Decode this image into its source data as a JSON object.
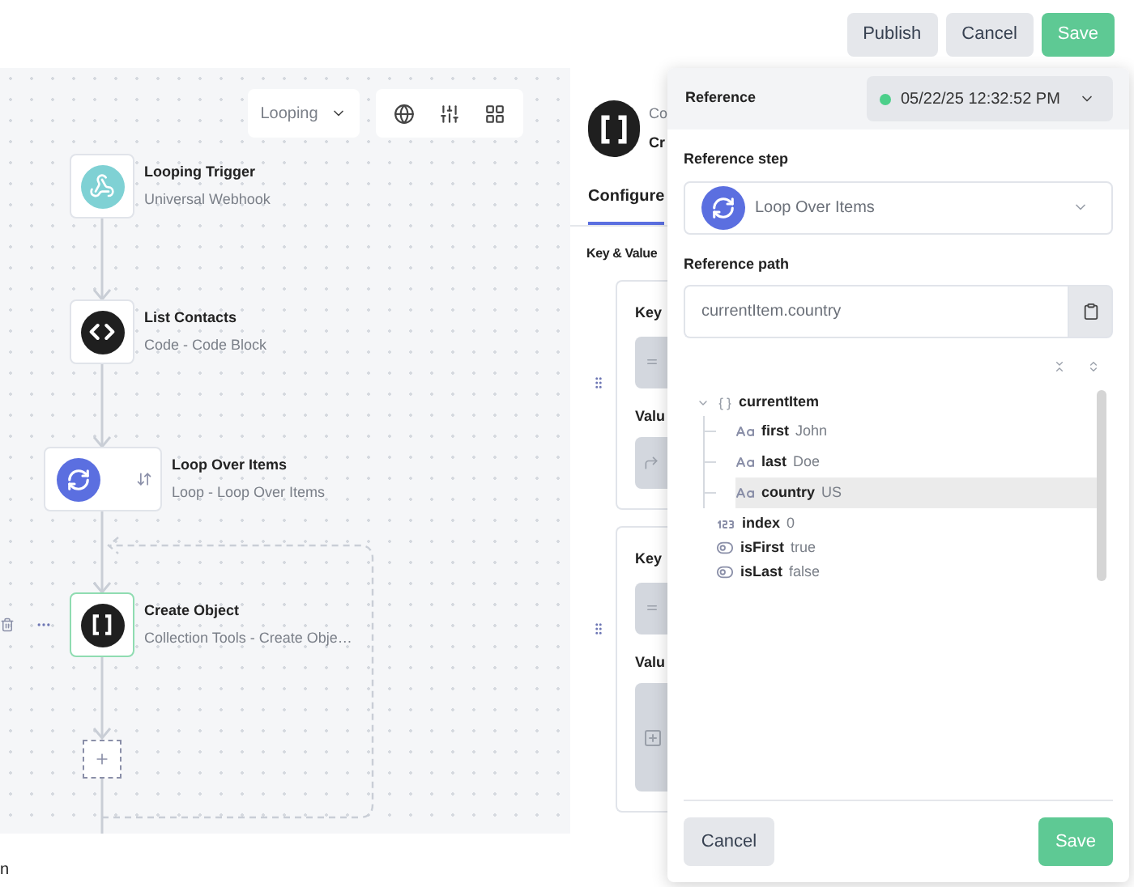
{
  "header": {
    "buttons": [
      {
        "label": "Publish",
        "kind": "secondary"
      },
      {
        "label": "Cancel",
        "kind": "secondary"
      },
      {
        "label": "Save",
        "kind": "primary"
      }
    ]
  },
  "canvas": {
    "view_select": "Looping",
    "nodes": [
      {
        "title": "Looping Trigger",
        "subtitle": "Universal Webhook",
        "kind": "webhook",
        "selected": false
      },
      {
        "title": "List Contacts",
        "subtitle": "Code - Code Block",
        "kind": "code",
        "selected": false
      },
      {
        "title": "Loop Over Items",
        "subtitle": "Loop - Loop Over Items",
        "kind": "loop",
        "selected": false
      },
      {
        "title": "Create Object",
        "subtitle": "Collection Tools - Create Obje…",
        "kind": "object",
        "selected": true
      }
    ]
  },
  "step_panel": {
    "title": "Co",
    "subtitle": "Cr",
    "tabs": [
      {
        "label": "Configure",
        "selected": true
      }
    ],
    "section": "Key & Value",
    "cards": [
      {
        "key_label": "Key",
        "value_label": "Valu",
        "kind": "reference"
      },
      {
        "key_label": "Key",
        "value_label": "Valu",
        "kind": "insert"
      }
    ]
  },
  "reference_popover": {
    "title": "Reference",
    "run": {
      "label": "05/22/25 12:32:52 PM",
      "color": "#4ccf8a"
    },
    "step_label": "Reference step",
    "step_value": "Loop Over Items",
    "path_label": "Reference path",
    "path_value": "currentItem.country",
    "tree": [
      {
        "kind": "object",
        "key": "currentItem",
        "expanded": true,
        "selected": false,
        "children": [
          {
            "kind": "string",
            "key": "first",
            "value": "John",
            "selected": false
          },
          {
            "kind": "string",
            "key": "last",
            "value": "Doe",
            "selected": false
          },
          {
            "kind": "string",
            "key": "country",
            "value": "US",
            "selected": true
          }
        ]
      },
      {
        "kind": "number",
        "key": "index",
        "value": "0",
        "selected": false
      },
      {
        "kind": "boolean",
        "key": "isFirst",
        "value": "true",
        "selected": false
      },
      {
        "kind": "boolean",
        "key": "isLast",
        "value": "false",
        "selected": false
      }
    ],
    "buttons": [
      {
        "label": "Cancel",
        "kind": "secondary"
      },
      {
        "label": "Save",
        "kind": "primary"
      }
    ]
  },
  "footer_text": "n"
}
